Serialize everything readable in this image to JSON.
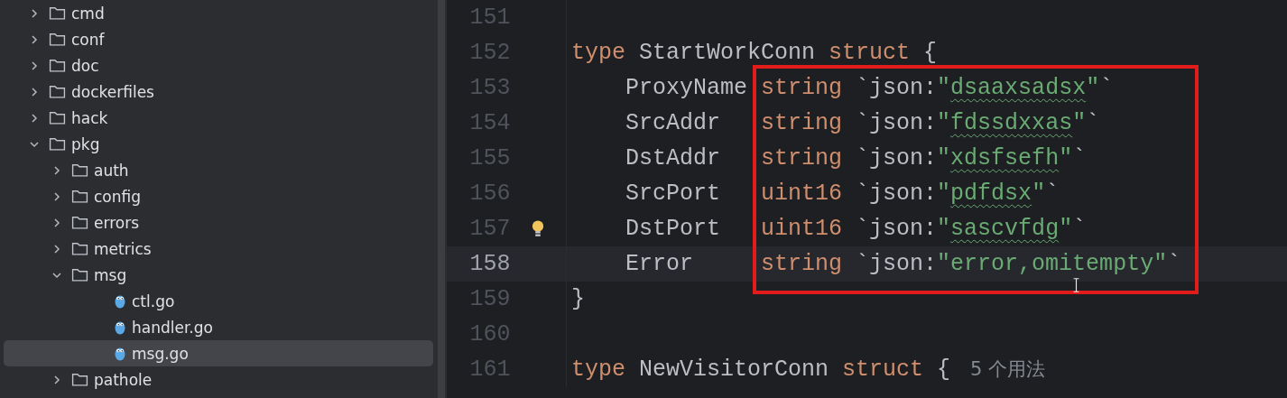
{
  "project_tree": {
    "items": [
      {
        "kind": "folder",
        "name": "cmd",
        "expanded": false,
        "selected": false
      },
      {
        "kind": "folder",
        "name": "conf",
        "expanded": false,
        "selected": false
      },
      {
        "kind": "folder",
        "name": "doc",
        "expanded": false,
        "selected": false
      },
      {
        "kind": "folder",
        "name": "dockerfiles",
        "expanded": false,
        "selected": false
      },
      {
        "kind": "folder",
        "name": "hack",
        "expanded": false,
        "selected": false
      },
      {
        "kind": "folder",
        "name": "pkg",
        "expanded": true,
        "selected": false,
        "children": [
          {
            "kind": "folder",
            "name": "auth",
            "expanded": false,
            "selected": false
          },
          {
            "kind": "folder",
            "name": "config",
            "expanded": false,
            "selected": false
          },
          {
            "kind": "folder",
            "name": "errors",
            "expanded": false,
            "selected": false
          },
          {
            "kind": "folder",
            "name": "metrics",
            "expanded": false,
            "selected": false
          },
          {
            "kind": "folder",
            "name": "msg",
            "expanded": true,
            "selected": false,
            "children": [
              {
                "kind": "file",
                "name": "ctl.go",
                "selected": false
              },
              {
                "kind": "file",
                "name": "handler.go",
                "selected": false
              },
              {
                "kind": "file",
                "name": "msg.go",
                "selected": true
              }
            ]
          },
          {
            "kind": "folder",
            "name": "pathole",
            "expanded": false,
            "selected": false
          }
        ]
      }
    ]
  },
  "editor": {
    "lines": [
      {
        "number": "151",
        "current": false,
        "bulb": false
      },
      {
        "number": "152",
        "current": false,
        "bulb": false,
        "tokens": [
          {
            "kind": "keyword",
            "text": "type"
          },
          {
            "kind": "plain",
            "text": " StartWorkConn "
          },
          {
            "kind": "keyword",
            "text": "struct"
          },
          {
            "kind": "plain",
            "text": " {"
          }
        ]
      },
      {
        "number": "153",
        "current": false,
        "bulb": false,
        "tokens": [
          {
            "kind": "plain",
            "text": "    ProxyName "
          },
          {
            "kind": "keyword",
            "text": "string"
          },
          {
            "kind": "plain",
            "text": " `json:"
          },
          {
            "kind": "string",
            "text": "\""
          },
          {
            "kind": "typo",
            "text": "dsaaxsadsx"
          },
          {
            "kind": "string",
            "text": "\""
          },
          {
            "kind": "plain",
            "text": "`"
          }
        ]
      },
      {
        "number": "154",
        "current": false,
        "bulb": false,
        "tokens": [
          {
            "kind": "plain",
            "text": "    SrcAddr   "
          },
          {
            "kind": "keyword",
            "text": "string"
          },
          {
            "kind": "plain",
            "text": " `json:"
          },
          {
            "kind": "string",
            "text": "\""
          },
          {
            "kind": "typo",
            "text": "fdssdxxas"
          },
          {
            "kind": "string",
            "text": "\""
          },
          {
            "kind": "plain",
            "text": "`"
          }
        ]
      },
      {
        "number": "155",
        "current": false,
        "bulb": false,
        "tokens": [
          {
            "kind": "plain",
            "text": "    DstAddr   "
          },
          {
            "kind": "keyword",
            "text": "string"
          },
          {
            "kind": "plain",
            "text": " `json:"
          },
          {
            "kind": "string",
            "text": "\""
          },
          {
            "kind": "typo",
            "text": "xdsfsefh"
          },
          {
            "kind": "string",
            "text": "\""
          },
          {
            "kind": "plain",
            "text": "`"
          }
        ]
      },
      {
        "number": "156",
        "current": false,
        "bulb": false,
        "tokens": [
          {
            "kind": "plain",
            "text": "    SrcPort   "
          },
          {
            "kind": "keyword",
            "text": "uint16"
          },
          {
            "kind": "plain",
            "text": " `json:"
          },
          {
            "kind": "string",
            "text": "\""
          },
          {
            "kind": "typo",
            "text": "pdfdsx"
          },
          {
            "kind": "string",
            "text": "\""
          },
          {
            "kind": "plain",
            "text": "`"
          }
        ]
      },
      {
        "number": "157",
        "current": false,
        "bulb": true,
        "tokens": [
          {
            "kind": "plain",
            "text": "    DstPort   "
          },
          {
            "kind": "keyword",
            "text": "uint16"
          },
          {
            "kind": "plain",
            "text": " `json:"
          },
          {
            "kind": "string",
            "text": "\""
          },
          {
            "kind": "typo",
            "text": "sascvfdg"
          },
          {
            "kind": "string",
            "text": "\""
          },
          {
            "kind": "plain",
            "text": "`"
          }
        ]
      },
      {
        "number": "158",
        "current": true,
        "bulb": false,
        "tokens": [
          {
            "kind": "plain",
            "text": "    Error     "
          },
          {
            "kind": "keyword",
            "text": "string"
          },
          {
            "kind": "plain",
            "text": " `json:"
          },
          {
            "kind": "string",
            "text": "\"error,omitempty\""
          },
          {
            "kind": "plain",
            "text": "`"
          }
        ]
      },
      {
        "number": "159",
        "current": false,
        "bulb": false,
        "tokens": [
          {
            "kind": "plain",
            "text": "}"
          }
        ]
      },
      {
        "number": "160",
        "current": false,
        "bulb": false
      },
      {
        "number": "161",
        "current": false,
        "bulb": false,
        "tokens": [
          {
            "kind": "keyword",
            "text": "type"
          },
          {
            "kind": "plain",
            "text": " NewVisitorConn "
          },
          {
            "kind": "keyword",
            "text": "struct"
          },
          {
            "kind": "plain",
            "text": " {"
          },
          {
            "kind": "hint",
            "text": "5 个用法"
          }
        ]
      }
    ]
  }
}
